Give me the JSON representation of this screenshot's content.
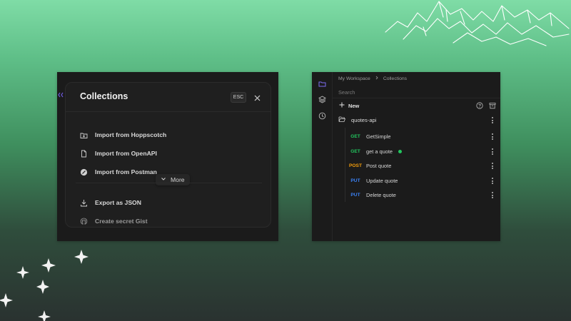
{
  "left_panel": {
    "modal": {
      "title": "Collections",
      "esc_label": "ESC",
      "items": [
        {
          "label": "Import from Hoppscotch",
          "icon": "folder-import-icon"
        },
        {
          "label": "Import from OpenAPI",
          "icon": "file-icon"
        },
        {
          "label": "Import from Postman",
          "icon": "postman-icon"
        },
        {
          "label": "Export as JSON",
          "icon": "download-icon"
        },
        {
          "label": "Create secret Gist",
          "icon": "github-icon"
        }
      ],
      "more_label": "More"
    }
  },
  "right_panel": {
    "breadcrumb": [
      "My Workspace",
      "Collections"
    ],
    "search_placeholder": "Search",
    "new_label": "New",
    "collection_name": "quotes-api",
    "requests": [
      {
        "method": "GET",
        "name": "GetSimple",
        "color": "#22c55e",
        "active": false
      },
      {
        "method": "GET",
        "name": "get a quote",
        "color": "#22c55e",
        "active": true
      },
      {
        "method": "POST",
        "name": "Post quote",
        "color": "#f59e0b",
        "active": false
      },
      {
        "method": "PUT",
        "name": "Update quote",
        "color": "#3b82f6",
        "active": false
      },
      {
        "method": "PUT",
        "name": "Delete quote",
        "color": "#3b82f6",
        "active": false
      }
    ],
    "accent": "#7c6cf0"
  }
}
